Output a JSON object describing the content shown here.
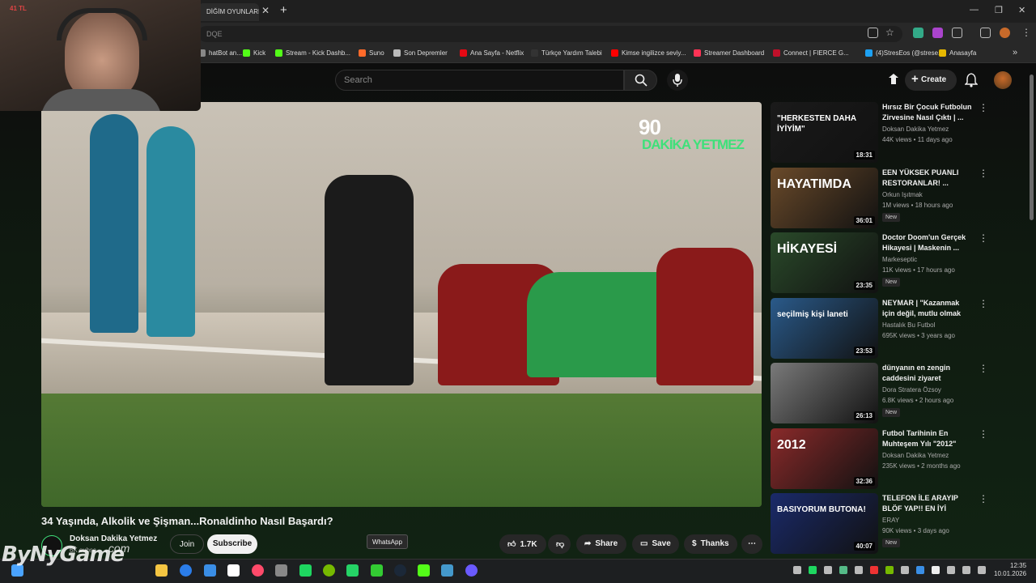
{
  "browser": {
    "tab_title": "DİĞİM OYUNLARI O",
    "omnibox_text": "DQE",
    "bookmarks": [
      "hatBot an...",
      "Kick",
      "Stream - Kick Dashb...",
      "Suno",
      "Son Depremler",
      "Ana Sayfa - Netflix",
      "Türkçe Yardım Talebi",
      "Kimse ingilizce seviy...",
      "Streamer Dashboard",
      "Connect | FIERCE G...",
      "(4)StresEos (@strese...",
      "Anasayfa"
    ],
    "bookmark_colors": [
      "#888",
      "#53fc18",
      "#53fc18",
      "#ff6a2a",
      "#bbb",
      "#e50914",
      "#333",
      "#ff0000",
      "#ff3355",
      "#c0102a",
      "#1da1f2",
      "#e6b800"
    ]
  },
  "webcam": {
    "tag": "41 TL"
  },
  "youtube": {
    "search_placeholder": "Search",
    "create_label": "Create",
    "video_watermark_num": "90",
    "video_watermark_text": "DAKİKA YETMEZ",
    "video_title": "34 Yaşında, Alkolik ve Şişman...Ronaldinho Nasıl Başardı?",
    "channel_name": "Doksan Dakika Yetmez",
    "channel_subs": "6K subsc",
    "join_label": "Join",
    "subscribe_label": "Subscribe",
    "like_count": "1.7K",
    "share_label": "Share",
    "save_label": "Save",
    "thanks_label": "Thanks",
    "tooltip": "WhatsApp",
    "recommendations": [
      {
        "title": "Hırsız Bir Çocuk Futbolun Zirvesine Nasıl Çıktı | ...",
        "channel": "Doksan Dakika Yetmez",
        "meta": "44K views • 11 days ago",
        "duration": "18:31",
        "new": "",
        "thumb_text": "\"HERKESTEN DAHA İYİYİM\"",
        "bg": "#1a1a1a"
      },
      {
        "title": "EEN YÜKSEK PUANLI RESTORANLAR! ...",
        "channel": "Orkun Işıtmak",
        "meta": "1M views • 18 hours ago",
        "duration": "36:01",
        "new": "New",
        "thumb_text": "HAYATIMDA",
        "bg": "#6a4a2a"
      },
      {
        "title": "Doctor Doom'un Gerçek Hikayesi | Maskenin ...",
        "channel": "Markeseptic",
        "meta": "11K views • 17 hours ago",
        "duration": "23:35",
        "new": "New",
        "thumb_text": "HİKAYESİ",
        "bg": "#2a4a2a"
      },
      {
        "title": "NEYMAR | \"Kazanmak için değil, mutlu olmak için ...",
        "channel": "Hastalık Bu Futbol",
        "meta": "695K views • 3 years ago",
        "duration": "23:53",
        "new": "",
        "thumb_text": "seçilmiş kişi laneti",
        "bg": "#2a5a8a"
      },
      {
        "title": "dünyanın en zengin caddesini ziyaret",
        "channel": "Dora Stratera Özsoy",
        "meta": "6.8K views • 2 hours ago",
        "duration": "26:13",
        "new": "New",
        "thumb_text": "",
        "bg": "#7a7a7a"
      },
      {
        "title": "Futbol Tarihinin En Muhteşem Yılı \"2012\"",
        "channel": "Doksan Dakika Yetmez",
        "meta": "235K views • 2 months ago",
        "duration": "32:36",
        "new": "",
        "thumb_text": "2012",
        "bg": "#8a2a2a"
      },
      {
        "title": "TELEFON İLE ARAYIP BLÖF YAP!! EN İYİ YALA...",
        "channel": "ERAY",
        "meta": "90K views • 3 days ago",
        "duration": "40:07",
        "new": "New",
        "thumb_text": "BASIYORUM BUTONA!",
        "bg": "#1a2a6a"
      }
    ]
  },
  "overlay": {
    "logo": "ByNyGame",
    "sub": ".com"
  },
  "taskbar": {
    "clock_time": "12:35",
    "clock_date": "10.01.2026",
    "app_colors": [
      "#4aa3ff",
      "#f4c542",
      "#2b7de9",
      "#3a8ee6",
      "#ffffff",
      "#ff4a6a",
      "#888",
      "#1ed760",
      "#76b900",
      "#25d366",
      "#33cc33",
      "#1b2838",
      "#53fc18",
      "#49c",
      "#6a5aff"
    ]
  }
}
